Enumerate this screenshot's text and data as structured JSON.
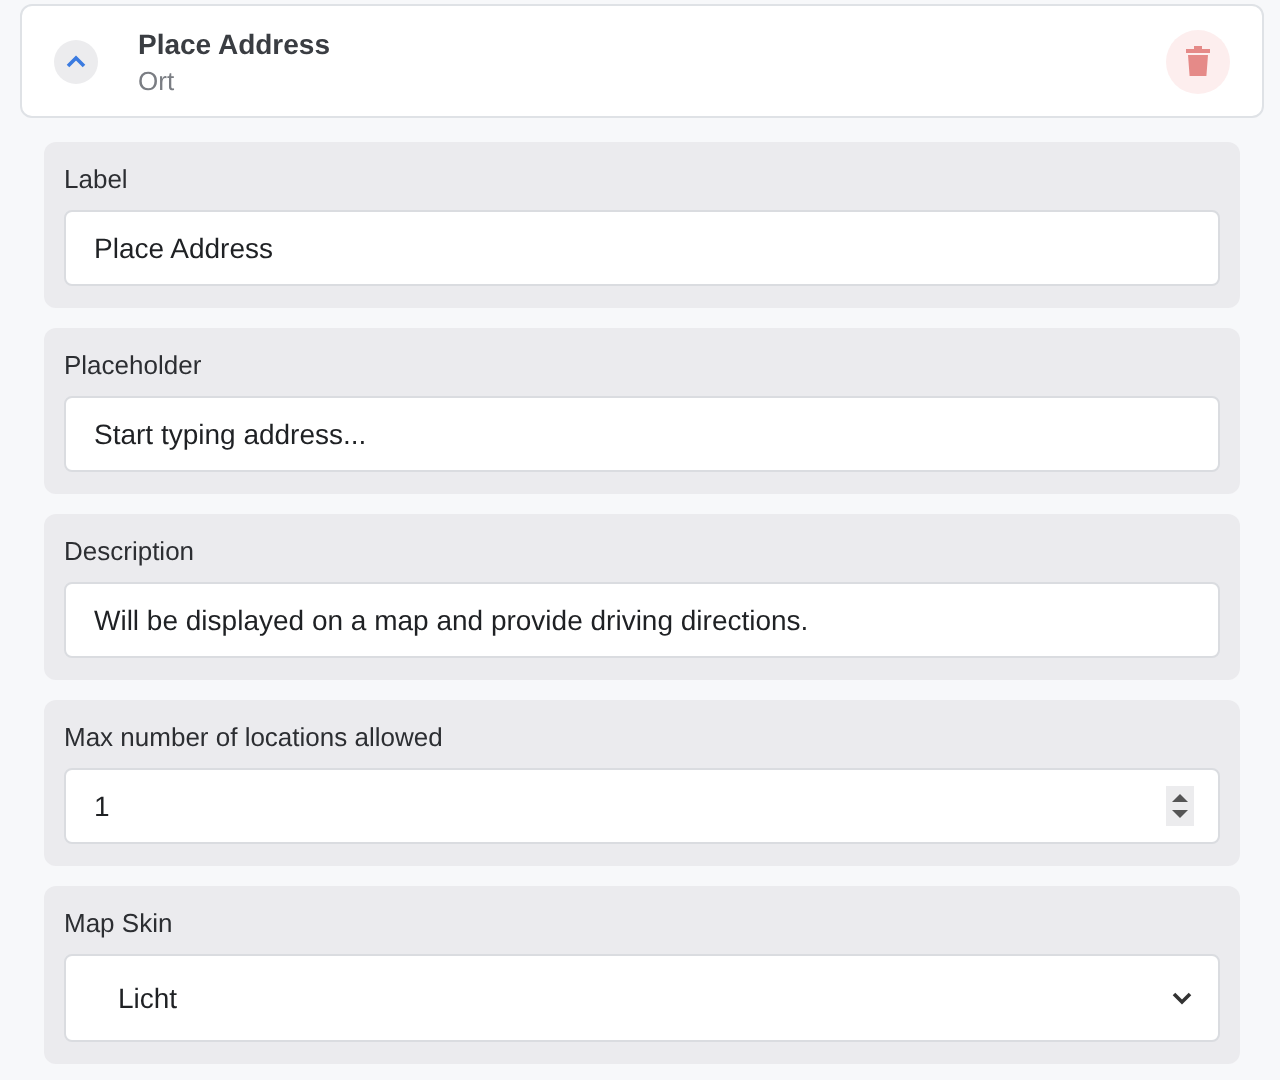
{
  "header": {
    "title": "Place Address",
    "subtitle": "Ort",
    "expanded": true
  },
  "fields": [
    {
      "kind": "text",
      "label": "Label",
      "value": "Place Address"
    },
    {
      "kind": "text",
      "label": "Placeholder",
      "value": "Start typing address..."
    },
    {
      "kind": "text",
      "label": "Description",
      "value": "Will be displayed on a map and provide driving directions."
    },
    {
      "kind": "number",
      "label": "Max number of locations allowed",
      "value": "1"
    },
    {
      "kind": "select",
      "label": "Map Skin",
      "value": "Licht"
    }
  ]
}
